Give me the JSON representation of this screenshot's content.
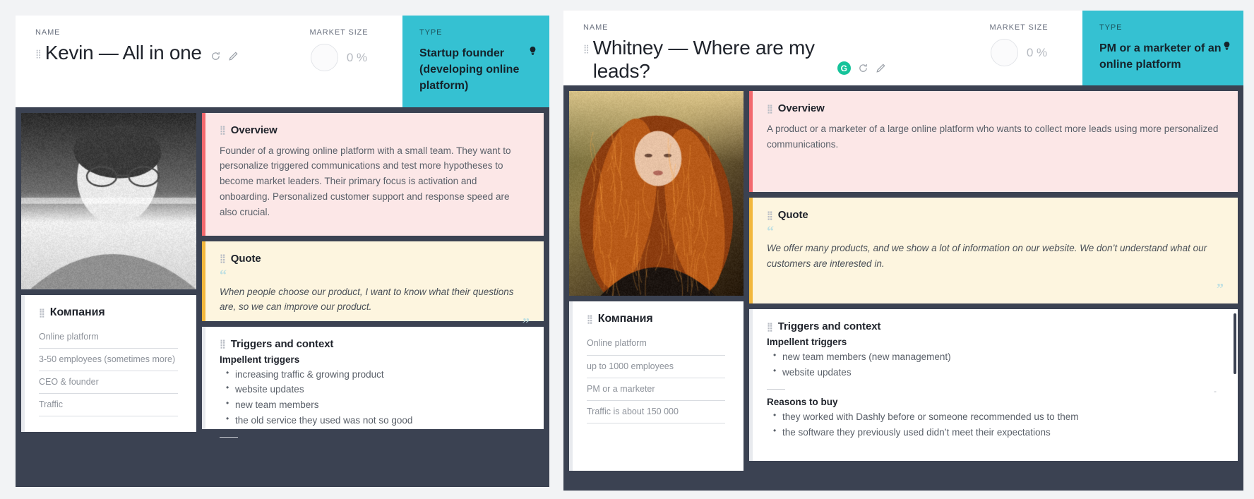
{
  "personas": [
    {
      "id": "kevin",
      "header": {
        "name_label": "NAME",
        "name": "Kevin — All in one",
        "market_label": "MARKET SIZE",
        "market_value": "0 %",
        "type_label": "TYPE",
        "type_value": "Startup founder (developing online platform)",
        "icons": {
          "refresh": "refresh-icon",
          "edit": "edit-icon",
          "bulb": "lightbulb-icon"
        }
      },
      "overview": {
        "title": "Overview",
        "text": "Founder of a growing online platform with a small team. They want to personalize triggered communications and test more hypotheses to become market leaders. Their primary focus is activation and onboarding. Personalized customer support and response speed are also crucial."
      },
      "quote": {
        "title": "Quote",
        "text": "When people choose our product, I want to know what their questions are, so we can improve our product.",
        "open_mark": "“",
        "close_mark": "”"
      },
      "triggers": {
        "title": "Triggers and context",
        "sections": [
          {
            "heading": "Impellent triggers",
            "items": [
              "increasing traffic & growing product",
              "website updates",
              "new team members",
              "the old service they used was not so good"
            ]
          }
        ]
      },
      "company": {
        "title": "Компания",
        "fields": [
          "Online platform",
          "3-50 employees (sometimes more)",
          "CEO & founder",
          "Traffic"
        ]
      },
      "photo_alt": "portrait-young-man-glasses-black-and-white"
    },
    {
      "id": "whitney",
      "header": {
        "name_label": "NAME",
        "name": "Whitney — Where are my leads?",
        "market_label": "MARKET SIZE",
        "market_value": "0 %",
        "type_label": "TYPE",
        "type_value": "PM or a marketer of an online platform",
        "grammarly_badge": "G",
        "icons": {
          "refresh": "refresh-icon",
          "edit": "edit-icon",
          "bulb": "lightbulb-icon"
        }
      },
      "overview": {
        "title": "Overview",
        "text": "A product or a marketer of a large online platform who wants to collect more leads using more personalized communications."
      },
      "quote": {
        "title": "Quote",
        "text": "We offer many products, and we show a lot of information on our website. We don’t understand what our customers are interested in.",
        "open_mark": "“",
        "close_mark": "”"
      },
      "triggers": {
        "title": "Triggers and context",
        "sections": [
          {
            "heading": "Impellent triggers",
            "items": [
              "new team members (new management)",
              "website updates"
            ]
          },
          {
            "heading": "Reasons to buy",
            "items": [
              "they worked with Dashly before or someone recommended us to them",
              "the software they previously used didn’t meet their expectations"
            ]
          }
        ]
      },
      "company": {
        "title": "Компания",
        "fields": [
          "Online platform",
          "up to 1000 employees",
          "PM or a marketer",
          "Traffic is about 150 000"
        ]
      },
      "photo_alt": "portrait-red-haired-woman-golden-hour"
    }
  ],
  "colors": {
    "board_bg": "#3b4252",
    "type_accent": "#35c1d2",
    "overview_bg": "#fce7e7",
    "overview_bar": "#f2696e",
    "quote_bg": "#fdf5df",
    "quote_bar": "#f2b73d",
    "grammarly_green": "#15c39a",
    "page_bg": "#f2f3f5"
  },
  "misc": {
    "grip": "⠿",
    "dash": "-"
  }
}
